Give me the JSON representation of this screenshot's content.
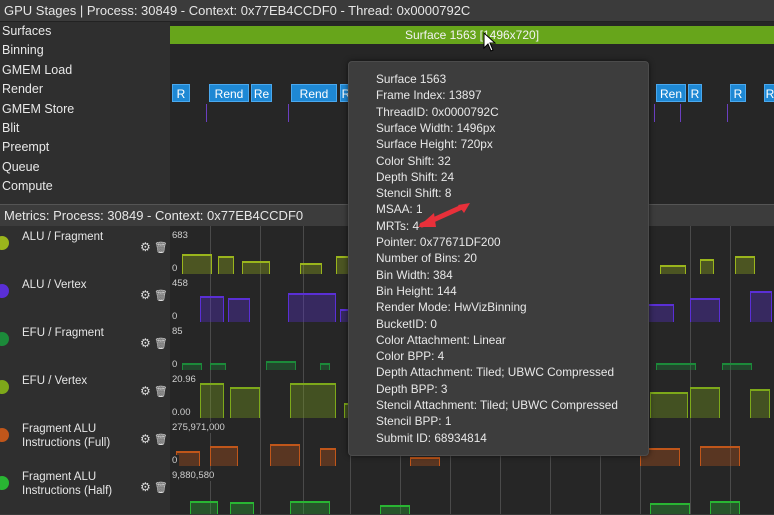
{
  "stages_panel": {
    "title": "GPU Stages | Process: 30849 - Context: 0x77EB4CCDF0 - Thread: 0x0000792C",
    "stages": [
      "Surfaces",
      "Binning",
      "GMEM Load",
      "Render",
      "GMEM Store",
      "Blit",
      "Preempt",
      "Queue",
      "Compute"
    ],
    "surface_bar_label": "Surface 1563 [1496x720]",
    "render_chips": [
      "R",
      "Rend",
      "Re",
      "Rend",
      "R",
      "Ren",
      "R",
      "R",
      "R"
    ]
  },
  "metrics_panel": {
    "title": "Metrics: Process: 30849 - Context: 0x77EB4CCDF0",
    "rows": [
      {
        "name": "ALU / Fragment",
        "max": "683",
        "min": "0",
        "color": "#9ab51c"
      },
      {
        "name": "ALU / Vertex",
        "max": "458",
        "min": "0",
        "color": "#5a2fd6"
      },
      {
        "name": "EFU / Fragment",
        "max": "85",
        "min": "0",
        "color": "#1c8a3a"
      },
      {
        "name": "EFU / Vertex",
        "max": "20.96",
        "min": "0.00",
        "color": "#7da81a"
      },
      {
        "name": "Fragment ALU Instructions (Full)",
        "max": "275,971,000",
        "min": "0",
        "color": "#c0561a"
      },
      {
        "name": "Fragment ALU Instructions (Half)",
        "max": "9,880,580",
        "min": "",
        "color": "#29b533"
      }
    ]
  },
  "tooltip": {
    "lines": [
      "Surface  1563",
      "Frame Index: 13897",
      "ThreadID: 0x0000792C",
      "Surface Width: 1496px",
      "Surface Height: 720px",
      "Color Shift: 32",
      "Depth Shift: 24",
      "Stencil Shift: 8",
      "MSAA: 1",
      "MRTs: 4",
      "Pointer: 0x77671DF200",
      "Number of Bins: 20",
      "Bin Width: 384",
      "Bin Height: 144",
      "Render Mode: HwVizBinning",
      "BucketID: 0",
      "Color Attachment: Linear",
      "Color BPP: 4",
      "Depth Attachment: Tiled; UBWC Compressed",
      "Depth BPP: 3",
      "Stencil Attachment: Tiled; UBWC Compressed",
      "Stencil BPP: 1",
      "Submit ID: 68934814"
    ]
  },
  "colors": {
    "annotation_arrow": "#e8303a",
    "surface_bar": "#67a51b",
    "render_chip": "#1e88d4"
  }
}
